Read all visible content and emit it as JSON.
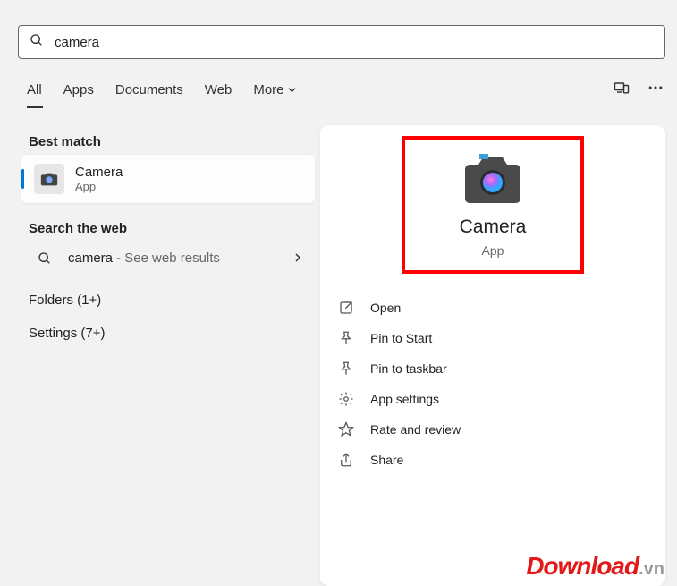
{
  "search": {
    "query": "camera"
  },
  "tabs": {
    "all": "All",
    "apps": "Apps",
    "documents": "Documents",
    "web": "Web",
    "more": "More"
  },
  "left": {
    "best_match": "Best match",
    "result": {
      "name": "Camera",
      "sub": "App"
    },
    "search_web": "Search the web",
    "web_query": "camera",
    "web_hint": "- See web results",
    "folders": "Folders (1+)",
    "settings": "Settings (7+)"
  },
  "right": {
    "name": "Camera",
    "sub": "App",
    "actions": {
      "open": "Open",
      "pin_start": "Pin to Start",
      "pin_taskbar": "Pin to taskbar",
      "app_settings": "App settings",
      "rate": "Rate and review",
      "share": "Share"
    }
  },
  "watermark": {
    "main": "Download",
    "suffix": ".vn"
  }
}
